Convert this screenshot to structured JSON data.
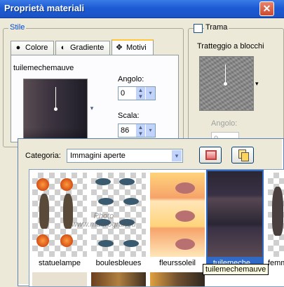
{
  "window": {
    "title": "Proprietà materiali",
    "close_glyph": "✕"
  },
  "stile": {
    "label": "Stile",
    "tabs": [
      {
        "label": "Colore",
        "icon": "filled-circle-icon",
        "glyph": "●"
      },
      {
        "label": "Gradiente",
        "icon": "half-circle-icon",
        "glyph": "◐"
      },
      {
        "label": "Motivi",
        "icon": "pattern-icon",
        "glyph": "✥",
        "active": true
      }
    ],
    "pattern_name": "tuilemechemauve",
    "angolo_label": "Angolo:",
    "angolo_value": "0",
    "scala_label": "Scala:",
    "scala_value": "86"
  },
  "trama": {
    "label": "Trama",
    "checked": false,
    "texture_name": "Tratteggio a blocchi",
    "angolo_label": "Angolo:",
    "angolo_value": "0"
  },
  "popup": {
    "categoria_label": "Categoria:",
    "categoria_value": "Immagini aperte",
    "thumbnails": [
      {
        "caption": "statuelampe"
      },
      {
        "caption": "boulesbleues"
      },
      {
        "caption": "fleurssoleil"
      },
      {
        "caption": "tuilemeche...",
        "selected": true
      },
      {
        "caption": "femm"
      }
    ],
    "tooltip": "tuilemechemauve",
    "watermark_line1": "Photo",
    "watermark_line2": "www.maurograf.eu"
  },
  "colors": {
    "titlebar": "#1d5bd4",
    "selection": "#316ac5",
    "accent_tab": "#ffc83c"
  }
}
